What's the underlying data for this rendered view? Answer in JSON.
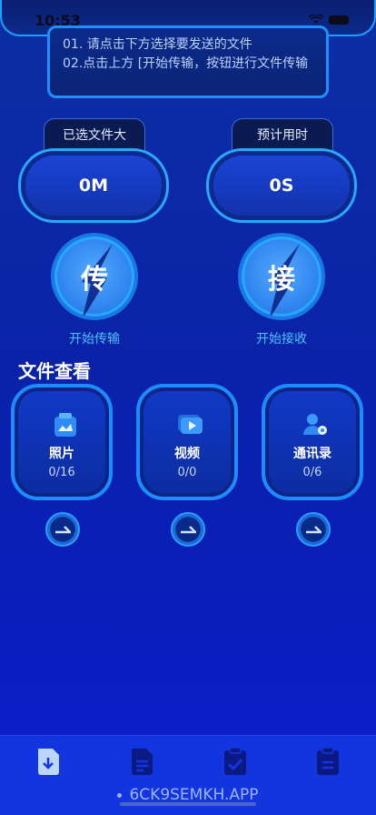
{
  "status": {
    "time": "10:53"
  },
  "notice": {
    "line1": "01. 请点击下方选择要发送的文件",
    "line2": "02.点击上方 [开始传输，按钮进行文件传输"
  },
  "stats": {
    "size_label": "已选文件大小",
    "size_value": "0M",
    "time_label": "预计用时",
    "time_value": "0S"
  },
  "actions": {
    "send_glyph": "传",
    "send_label": "开始传输",
    "receive_glyph": "接",
    "receive_label": "开始接收"
  },
  "files": {
    "title": "文件查看",
    "items": [
      {
        "name": "照片",
        "count": "0/16",
        "icon": "photo-icon"
      },
      {
        "name": "视频",
        "count": "0/0",
        "icon": "video-icon"
      },
      {
        "name": "通讯录",
        "count": "0/6",
        "icon": "contacts-icon"
      }
    ]
  },
  "tabs": [
    {
      "icon": "download-file-icon",
      "active": true
    },
    {
      "icon": "document-icon",
      "active": false
    },
    {
      "icon": "clipboard-check-icon",
      "active": false
    },
    {
      "icon": "clipboard-icon",
      "active": false
    }
  ],
  "browser": {
    "url": "6CK9SEMKH.APP"
  },
  "colors": {
    "accent": "#1e90ff",
    "caption": "#49c4ff",
    "tabbar": "#1335e0"
  }
}
